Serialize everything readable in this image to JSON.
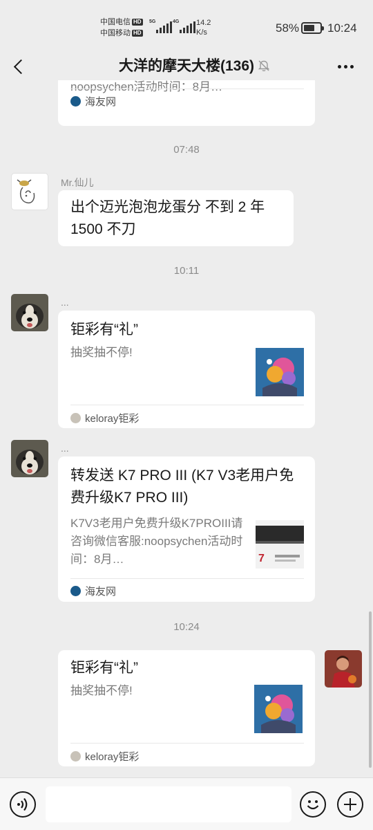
{
  "status_bar": {
    "carrier1": "中国电信",
    "carrier2": "中国移动",
    "hd": "HD",
    "net1": "5G",
    "net2": "4G",
    "speed_value": "14.2",
    "speed_unit": "K/s",
    "battery": "58%",
    "battery_level": 0.58,
    "time": "10:24"
  },
  "header": {
    "title": "大洋的摩天大楼(136)"
  },
  "messages": {
    "card0": {
      "desc_partial": "noopsychen活动时间：8月…",
      "source": "海友网",
      "source_color": "#1a5a8a"
    },
    "ts1": "07:48",
    "msg1": {
      "sender": "Mr.仙儿",
      "text": "出个迈光泡泡龙蛋分 不到 2 年 1500 不刀"
    },
    "ts2": "10:11",
    "card1": {
      "sender": "...",
      "title": "钜彩有“礼”",
      "desc": "抽奖抽不停!",
      "source": "keloray钜彩"
    },
    "card2": {
      "sender": "...",
      "title": "转发送 K7 PRO III (K7 V3老用户免费升级K7 PRO III)",
      "desc": "K7V3老用户免费升级K7PROIII请咨询微信客服:noopsychen活动时间：8月…",
      "source": "海友网"
    },
    "ts3": "10:24",
    "card3": {
      "title": "钜彩有“礼”",
      "desc": "抽奖抽不停!",
      "source": "keloray钜彩"
    }
  },
  "input": {
    "placeholder": ""
  }
}
